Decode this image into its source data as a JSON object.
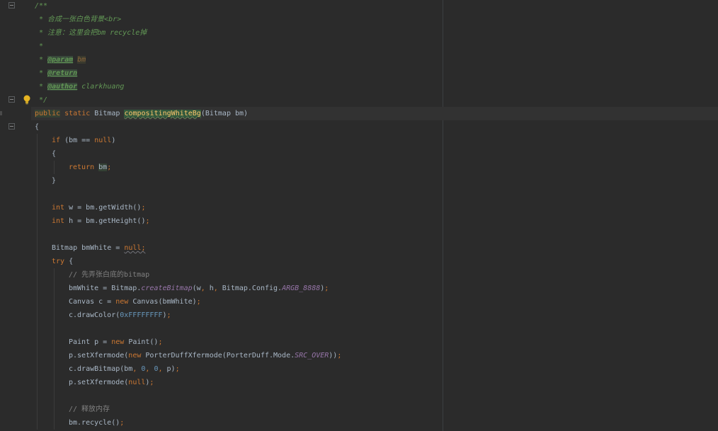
{
  "editor": {
    "lines": [
      {
        "indent": 0,
        "tokens": [
          {
            "t": "/**",
            "s": "t-doc"
          }
        ]
      },
      {
        "indent": 0,
        "tokens": [
          {
            "t": " * 合成一张白色背景<br>",
            "s": "t-doc"
          }
        ]
      },
      {
        "indent": 0,
        "tokens": [
          {
            "t": " * 注意：这里会把",
            "s": "t-doc"
          },
          {
            "t": "bm recycle",
            "s": "t-doc"
          },
          {
            "t": "掉",
            "s": "t-doc"
          }
        ]
      },
      {
        "indent": 0,
        "tokens": [
          {
            "t": " *",
            "s": "t-doc"
          }
        ]
      },
      {
        "indent": 0,
        "tokens": [
          {
            "t": " * ",
            "s": "t-doc"
          },
          {
            "t": "@param",
            "s": "t-doctag"
          },
          {
            "t": " ",
            "s": "t-doc"
          },
          {
            "t": "bm",
            "s": "t-docparam"
          }
        ]
      },
      {
        "indent": 0,
        "tokens": [
          {
            "t": " * ",
            "s": "t-doc"
          },
          {
            "t": "@return",
            "s": "t-doctag"
          }
        ]
      },
      {
        "indent": 0,
        "tokens": [
          {
            "t": " * ",
            "s": "t-doc"
          },
          {
            "t": "@author",
            "s": "t-doctag"
          },
          {
            "t": " clarkhuang",
            "s": "t-doc"
          }
        ]
      },
      {
        "indent": 0,
        "tokens": [
          {
            "t": " */",
            "s": "t-doc"
          }
        ]
      },
      {
        "indent": 0,
        "current": true,
        "tokens": [
          {
            "t": "public",
            "s": "t-kw-hl"
          },
          {
            "t": " static ",
            "s": "t-kw"
          },
          {
            "t": "Bitmap ",
            "s": "t-plain"
          },
          {
            "t": "compositingWhiteBg",
            "s": "t-method"
          },
          {
            "t": "(Bitmap bm)",
            "s": "t-plain"
          }
        ]
      },
      {
        "indent": 0,
        "tokens": [
          {
            "t": "{",
            "s": "t-plain"
          }
        ]
      },
      {
        "indent": 1,
        "tokens": [
          {
            "t": "if",
            "s": "t-kw"
          },
          {
            "t": " (bm == ",
            "s": "t-plain"
          },
          {
            "t": "null",
            "s": "t-kw"
          },
          {
            "t": ")",
            "s": "t-plain"
          }
        ]
      },
      {
        "indent": 1,
        "tokens": [
          {
            "t": "{",
            "s": "t-plain"
          }
        ]
      },
      {
        "indent": 2,
        "tokens": [
          {
            "t": "return ",
            "s": "t-kw"
          },
          {
            "t": "bm",
            "s": "t-var-hl"
          },
          {
            "t": ";",
            "s": "t-kw"
          }
        ]
      },
      {
        "indent": 1,
        "tokens": [
          {
            "t": "}",
            "s": "t-plain"
          }
        ]
      },
      {
        "indent": 1,
        "tokens": []
      },
      {
        "indent": 1,
        "tokens": [
          {
            "t": "int ",
            "s": "t-kw"
          },
          {
            "t": "w = bm.getWidth()",
            "s": "t-plain"
          },
          {
            "t": ";",
            "s": "t-kw"
          }
        ]
      },
      {
        "indent": 1,
        "tokens": [
          {
            "t": "int ",
            "s": "t-kw"
          },
          {
            "t": "h = bm.getHeight()",
            "s": "t-plain"
          },
          {
            "t": ";",
            "s": "t-kw"
          }
        ]
      },
      {
        "indent": 1,
        "tokens": []
      },
      {
        "indent": 1,
        "tokens": [
          {
            "t": "Bitmap bmWhite = ",
            "s": "t-plain"
          },
          {
            "t": "null;",
            "s": "t-warn"
          }
        ]
      },
      {
        "indent": 1,
        "tokens": [
          {
            "t": "try ",
            "s": "t-kw"
          },
          {
            "t": "{",
            "s": "t-plain"
          }
        ]
      },
      {
        "indent": 2,
        "tokens": [
          {
            "t": "// 先弄张白底的bitmap",
            "s": "t-comment"
          }
        ]
      },
      {
        "indent": 2,
        "tokens": [
          {
            "t": "bmWhite = Bitmap.",
            "s": "t-plain"
          },
          {
            "t": "createBitmap",
            "s": "t-static"
          },
          {
            "t": "(w",
            "s": "t-plain"
          },
          {
            "t": ", ",
            "s": "t-kw"
          },
          {
            "t": "h",
            "s": "t-plain"
          },
          {
            "t": ", ",
            "s": "t-kw"
          },
          {
            "t": "Bitmap.Config.",
            "s": "t-plain"
          },
          {
            "t": "ARGB_8888",
            "s": "t-static"
          },
          {
            "t": ")",
            "s": "t-plain"
          },
          {
            "t": ";",
            "s": "t-kw"
          }
        ]
      },
      {
        "indent": 2,
        "tokens": [
          {
            "t": "Canvas c = ",
            "s": "t-plain"
          },
          {
            "t": "new ",
            "s": "t-kw"
          },
          {
            "t": "Canvas(bmWhite)",
            "s": "t-plain"
          },
          {
            "t": ";",
            "s": "t-kw"
          }
        ]
      },
      {
        "indent": 2,
        "tokens": [
          {
            "t": "c.drawColor(",
            "s": "t-plain"
          },
          {
            "t": "0xFFFFFFFF",
            "s": "t-num"
          },
          {
            "t": ")",
            "s": "t-plain"
          },
          {
            "t": ";",
            "s": "t-kw"
          }
        ]
      },
      {
        "indent": 2,
        "tokens": []
      },
      {
        "indent": 2,
        "tokens": [
          {
            "t": "Paint p = ",
            "s": "t-plain"
          },
          {
            "t": "new ",
            "s": "t-kw"
          },
          {
            "t": "Paint()",
            "s": "t-plain"
          },
          {
            "t": ";",
            "s": "t-kw"
          }
        ]
      },
      {
        "indent": 2,
        "tokens": [
          {
            "t": "p.setXfermode(",
            "s": "t-plain"
          },
          {
            "t": "new ",
            "s": "t-kw"
          },
          {
            "t": "PorterDuffXfermode(PorterDuff.Mode.",
            "s": "t-plain"
          },
          {
            "t": "SRC_OVER",
            "s": "t-static"
          },
          {
            "t": "))",
            "s": "t-plain"
          },
          {
            "t": ";",
            "s": "t-kw"
          }
        ]
      },
      {
        "indent": 2,
        "tokens": [
          {
            "t": "c.drawBitmap(bm",
            "s": "t-plain"
          },
          {
            "t": ", ",
            "s": "t-kw"
          },
          {
            "t": "0",
            "s": "t-num"
          },
          {
            "t": ", ",
            "s": "t-kw"
          },
          {
            "t": "0",
            "s": "t-num"
          },
          {
            "t": ", ",
            "s": "t-kw"
          },
          {
            "t": "p)",
            "s": "t-plain"
          },
          {
            "t": ";",
            "s": "t-kw"
          }
        ]
      },
      {
        "indent": 2,
        "tokens": [
          {
            "t": "p.setXfermode(",
            "s": "t-plain"
          },
          {
            "t": "null",
            "s": "t-kw"
          },
          {
            "t": ")",
            "s": "t-plain"
          },
          {
            "t": ";",
            "s": "t-kw"
          }
        ]
      },
      {
        "indent": 2,
        "tokens": []
      },
      {
        "indent": 2,
        "tokens": [
          {
            "t": "// 释放内存",
            "s": "t-comment"
          }
        ]
      },
      {
        "indent": 2,
        "tokens": [
          {
            "t": "bm.recycle()",
            "s": "t-plain"
          },
          {
            "t": ";",
            "s": "t-kw"
          }
        ]
      }
    ]
  },
  "gutter": {
    "fold_marks": [
      0,
      7,
      9
    ],
    "bulb_line": 7,
    "bulb_icon": "lightbulb-icon",
    "fold_icon": "fold-toggle-icon"
  },
  "colors": {
    "background": "#2b2b2b",
    "keyword": "#cc7832",
    "doc_comment": "#629755",
    "method": "#ffc66d",
    "number": "#6897bb",
    "comment": "#808080",
    "static_field": "#9876aa"
  }
}
